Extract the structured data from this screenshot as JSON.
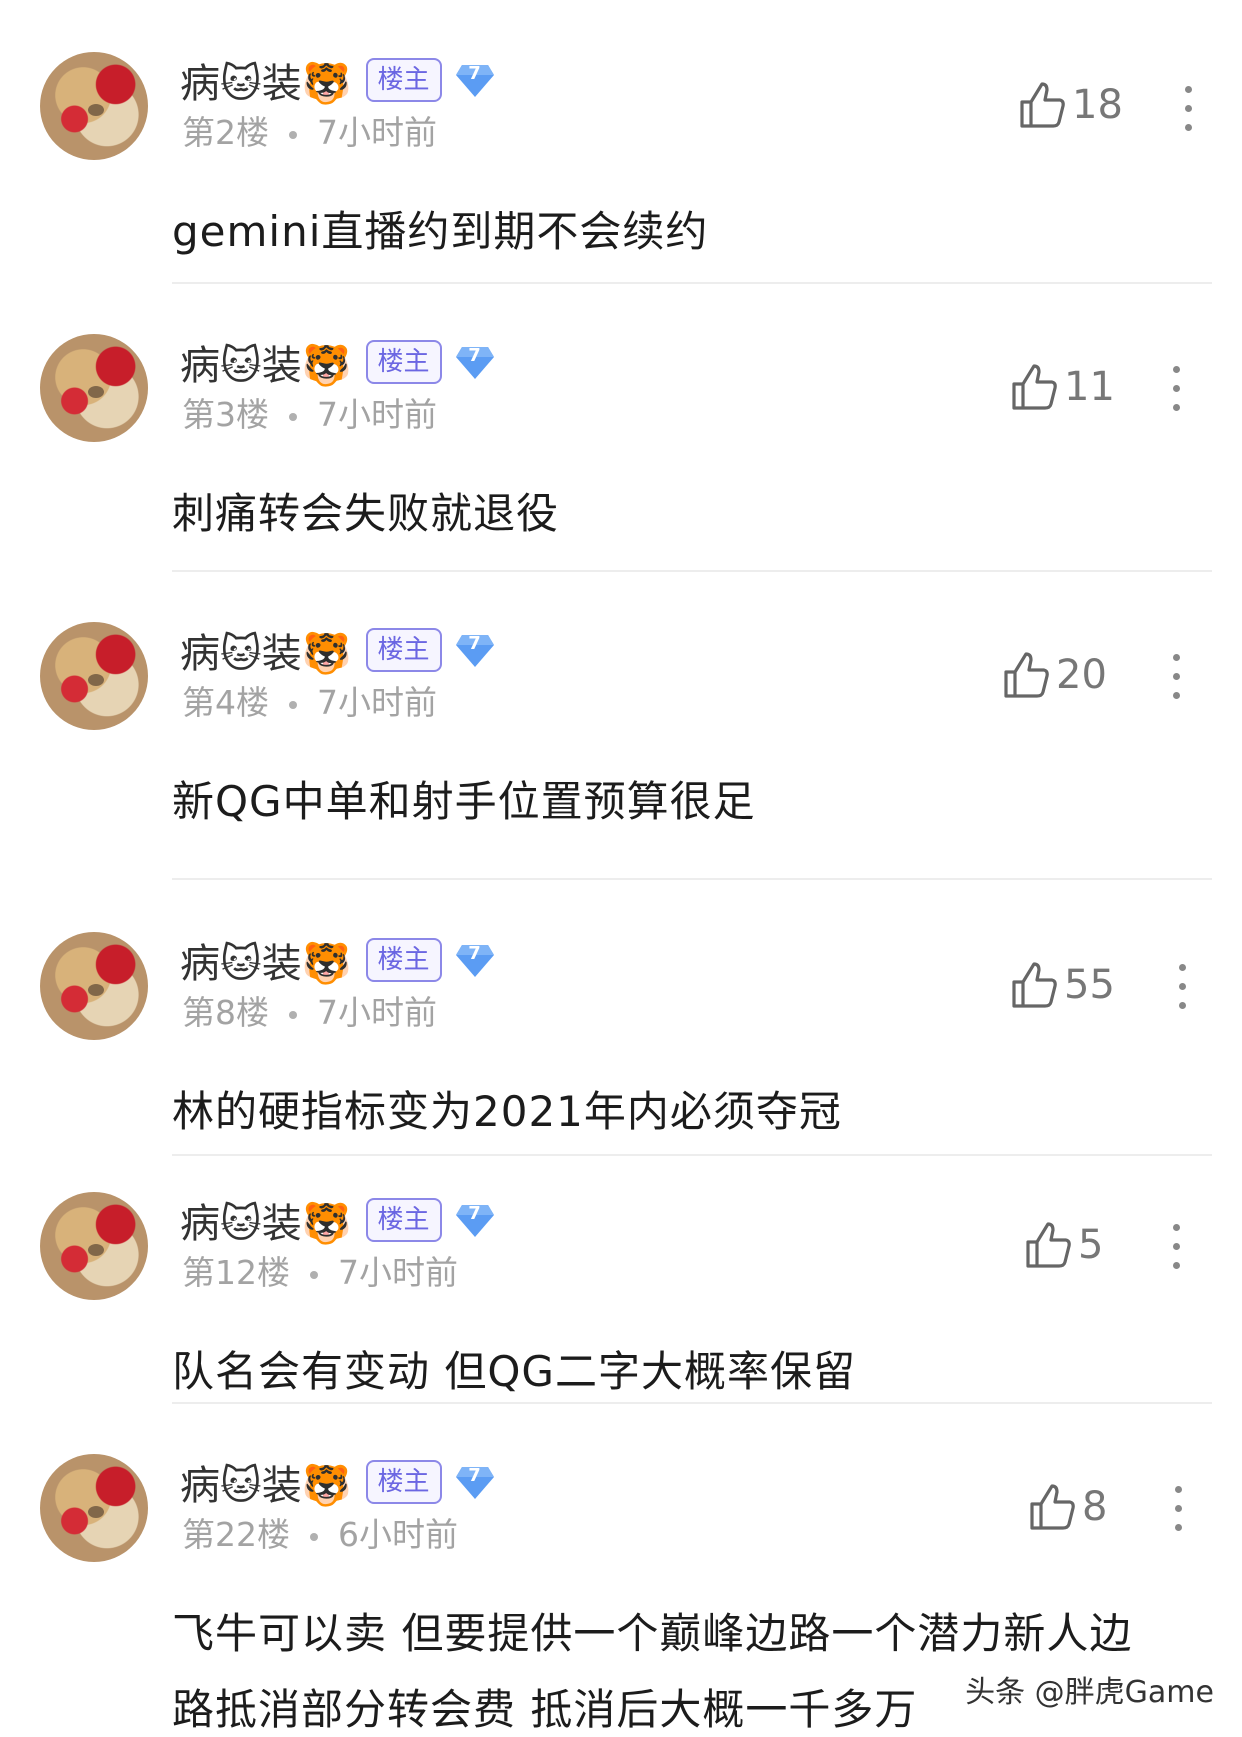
{
  "comments": [
    {
      "username_a": "病",
      "emoji_a": "🐱",
      "username_b": "装",
      "emoji_b": "🐯",
      "owner_badge": "楼主",
      "level": "7",
      "floor": "第2楼",
      "time": "7小时前",
      "likes": "18",
      "text": "gemini直播约到期不会续约"
    },
    {
      "username_a": "病",
      "emoji_a": "🐱",
      "username_b": "装",
      "emoji_b": "🐯",
      "owner_badge": "楼主",
      "level": "7",
      "floor": "第3楼",
      "time": "7小时前",
      "likes": "11",
      "text": "刺痛转会失败就退役"
    },
    {
      "username_a": "病",
      "emoji_a": "🐱",
      "username_b": "装",
      "emoji_b": "🐯",
      "owner_badge": "楼主",
      "level": "7",
      "floor": "第4楼",
      "time": "7小时前",
      "likes": "20",
      "text": "新QG中单和射手位置预算很足"
    },
    {
      "username_a": "病",
      "emoji_a": "🐱",
      "username_b": "装",
      "emoji_b": "🐯",
      "owner_badge": "楼主",
      "level": "7",
      "floor": "第8楼",
      "time": "7小时前",
      "likes": "55",
      "text": "林的硬指标变为2021年内必须夺冠"
    },
    {
      "username_a": "病",
      "emoji_a": "🐱",
      "username_b": "装",
      "emoji_b": "🐯",
      "owner_badge": "楼主",
      "level": "7",
      "floor": "第12楼",
      "time": "7小时前",
      "likes": "5",
      "text": "队名会有变动 但QG二字大概率保留"
    },
    {
      "username_a": "病",
      "emoji_a": "🐱",
      "username_b": "装",
      "emoji_b": "🐯",
      "owner_badge": "楼主",
      "level": "7",
      "floor": "第22楼",
      "time": "6小时前",
      "likes": "8",
      "text": "飞牛可以卖 但要提供一个巅峰边路一个潜力新人边",
      "text_line2": "路抵消部分转会费 抵消后大概一千多万"
    }
  ],
  "watermark": "头条 @胖虎Game",
  "colors": {
    "owner_badge": "#6b66e2",
    "level_badge": "#5b9cf3",
    "meta": "#a3a3a3"
  }
}
